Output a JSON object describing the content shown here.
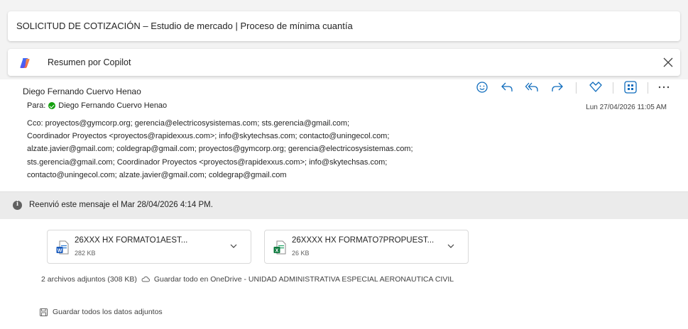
{
  "subject": "SOLICITUD DE COTIZACIÓN – Estudio de mercado | Proceso de mínima cuantía",
  "copilot": {
    "label": "Resumen por Copilot"
  },
  "message": {
    "sender": "Diego Fernando Cuervo Henao",
    "to_label": "Para:",
    "to_name": "Diego Fernando Cuervo Henao",
    "date": "Lun 27/04/2026 11:05 AM",
    "cco_lines": [
      "Cco: proyectos@gymcorp.org;  gerencia@electricosysistemas.com;  sts.gerencia@gmail.com;",
      "Coordinador Proyectos <proyectos@rapidexxus.com>;  info@skytechsas.com;  contacto@uningecol.com;",
      "alzate.javier@gmail.com;  coldegrap@gmail.com;  proyectos@gymcorp.org;  gerencia@electricosysistemas.com;",
      "sts.gerencia@gmail.com;  Coordinador Proyectos <proyectos@rapidexxus.com>;  info@skytechsas.com;",
      "contacto@uningecol.com;  alzate.javier@gmail.com;  coldegrap@gmail.com"
    ]
  },
  "toolbar_icons": [
    "emoji-icon",
    "reply-icon",
    "reply-all-icon",
    "forward-icon",
    "immersive-reader-icon",
    "apps-icon",
    "more-icon"
  ],
  "banner": {
    "text": "Reenvió este mensaje el Mar 28/04/2026 4:14 PM."
  },
  "attachments": [
    {
      "name": "26XXX HX FORMATO1AEST...",
      "size": "282 KB",
      "type": "word"
    },
    {
      "name": "26XXXX HX FORMATO7PROPUEST...",
      "size": "26 KB",
      "type": "excel"
    }
  ],
  "attachments_summary": "2 archivos adjuntos (308 KB)",
  "save_onedrive": "Guardar todo en OneDrive - UNIDAD ADMINISTRATIVA ESPECIAL AERONAUTICA CIVIL",
  "save_all": "Guardar todos los datos adjuntos",
  "colors": {
    "accent": "#0f6cbd",
    "presence": "#13a10e",
    "word": "#185abd",
    "excel": "#107c41"
  }
}
